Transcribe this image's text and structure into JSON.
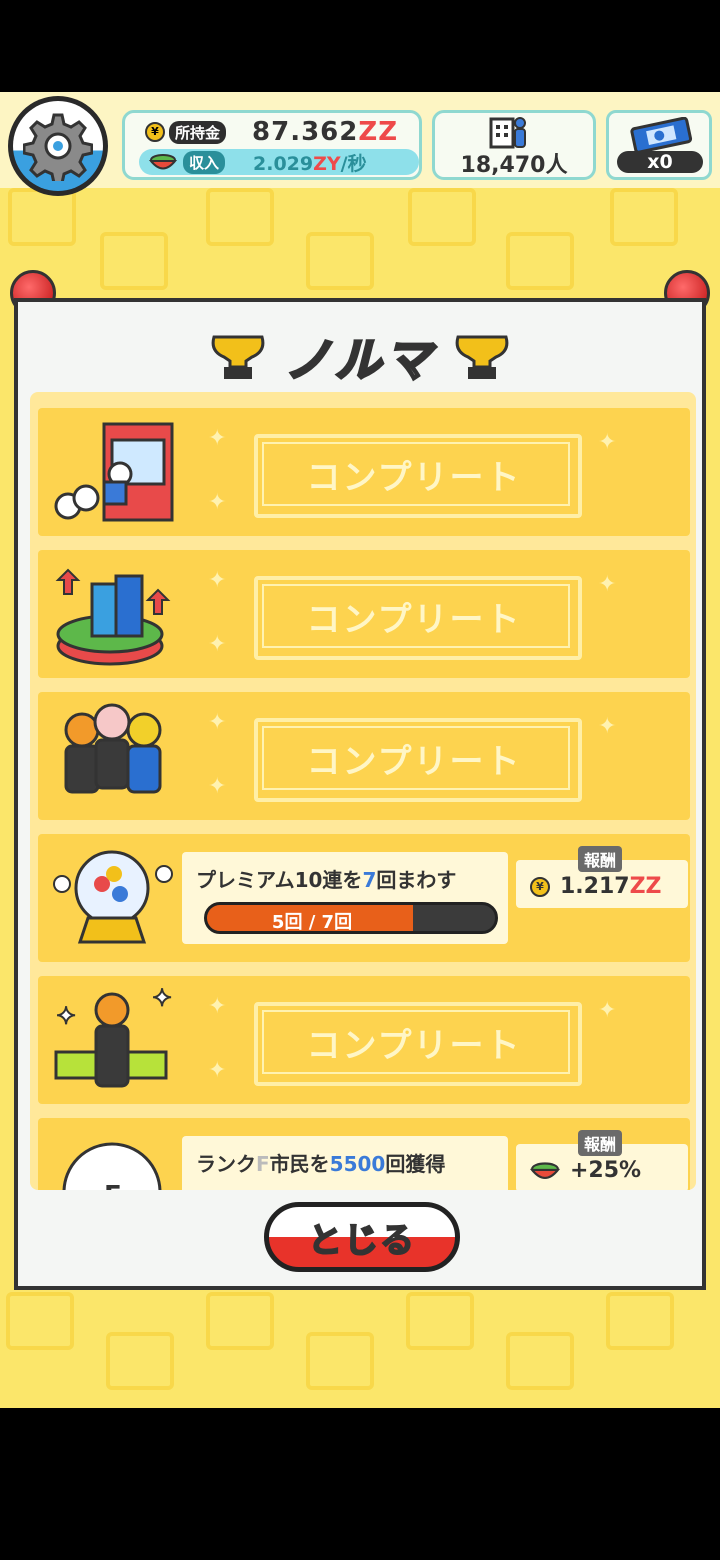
{
  "header": {
    "money_label": "所持金",
    "money_value": "87.362",
    "money_unit": "ZZ",
    "income_label": "収入",
    "income_value": "2.029",
    "income_unit": "ZY",
    "income_per": "/秒",
    "population": "18,470人",
    "ticket_count": "x0"
  },
  "modal": {
    "title": "ノルマ",
    "close_label": "とじる",
    "complete_text": "コンプリート",
    "items": [
      {
        "status": "complete"
      },
      {
        "status": "complete"
      },
      {
        "status": "complete"
      },
      {
        "status": "in_progress",
        "desc_a": "プレミアム10連を",
        "desc_num": "7",
        "desc_b": "回まわす",
        "progress_text": "5回 / 7回",
        "progress_fraction": 0.714,
        "reward_label": "報酬",
        "reward_value": "1.217",
        "reward_unit": "ZZ"
      },
      {
        "status": "complete"
      },
      {
        "status": "in_progress",
        "desc_a": "ランク",
        "desc_rank": "F",
        "desc_b": "市民を",
        "desc_num": "5500",
        "desc_c": "回獲得",
        "reward_label": "報酬",
        "reward_value": "+25%"
      }
    ]
  },
  "colors": {
    "background": "#fbe66a",
    "accent_red": "#ee4a4a",
    "accent_blue": "#3a7ad8",
    "progress_fill": "#e8601a"
  }
}
